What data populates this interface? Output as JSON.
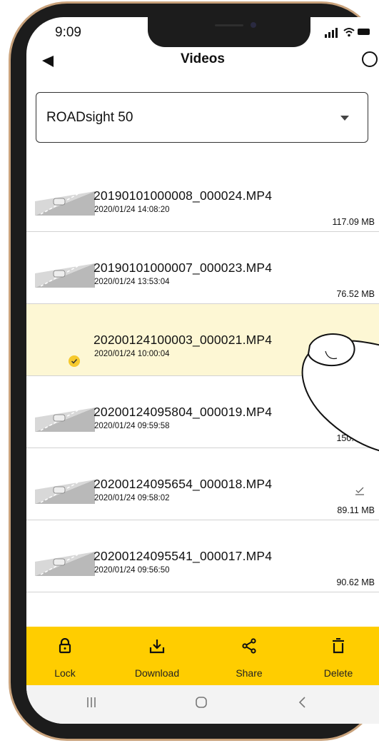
{
  "status_bar": {
    "time": "9:09"
  },
  "header": {
    "title": "Videos"
  },
  "device_select": {
    "value": "ROADsight 50"
  },
  "videos": [
    {
      "filename": "20190101000008_000024.MP4",
      "datetime": "2020/01/24 14:08:20",
      "size": "117.09 MB",
      "selected": false,
      "downloaded": false
    },
    {
      "filename": "20190101000007_000023.MP4",
      "datetime": "2020/01/24 13:53:04",
      "size": "76.52 MB",
      "selected": false,
      "downloaded": false
    },
    {
      "filename": "20200124100003_000021.MP4",
      "datetime": "2020/01/24 10:00:04",
      "size": "",
      "selected": true,
      "downloaded": false
    },
    {
      "filename": "20200124095804_000019.MP4",
      "datetime": "2020/01/24 09:59:58",
      "size": "150.9 MB",
      "selected": false,
      "downloaded": false
    },
    {
      "filename": "20200124095654_000018.MP4",
      "datetime": "2020/01/24 09:58:02",
      "size": "89.11 MB",
      "selected": false,
      "downloaded": true
    },
    {
      "filename": "20200124095541_000017.MP4",
      "datetime": "2020/01/24 09:56:50",
      "size": "90.62 MB",
      "selected": false,
      "downloaded": false
    }
  ],
  "actions": {
    "lock": "Lock",
    "download": "Download",
    "share": "Share",
    "delete": "Delete"
  },
  "colors": {
    "accent": "#ffcd00",
    "selected_row": "#fdf7d4",
    "check_badge": "#f6c92d",
    "frame": "#c9a27b"
  },
  "icons": [
    "back-arrow-icon",
    "select-all-circle-icon",
    "dropdown-caret-icon",
    "lock-icon",
    "download-icon",
    "share-icon",
    "delete-icon",
    "recent-apps-icon",
    "home-icon",
    "back-nav-icon",
    "checkmark-icon"
  ]
}
